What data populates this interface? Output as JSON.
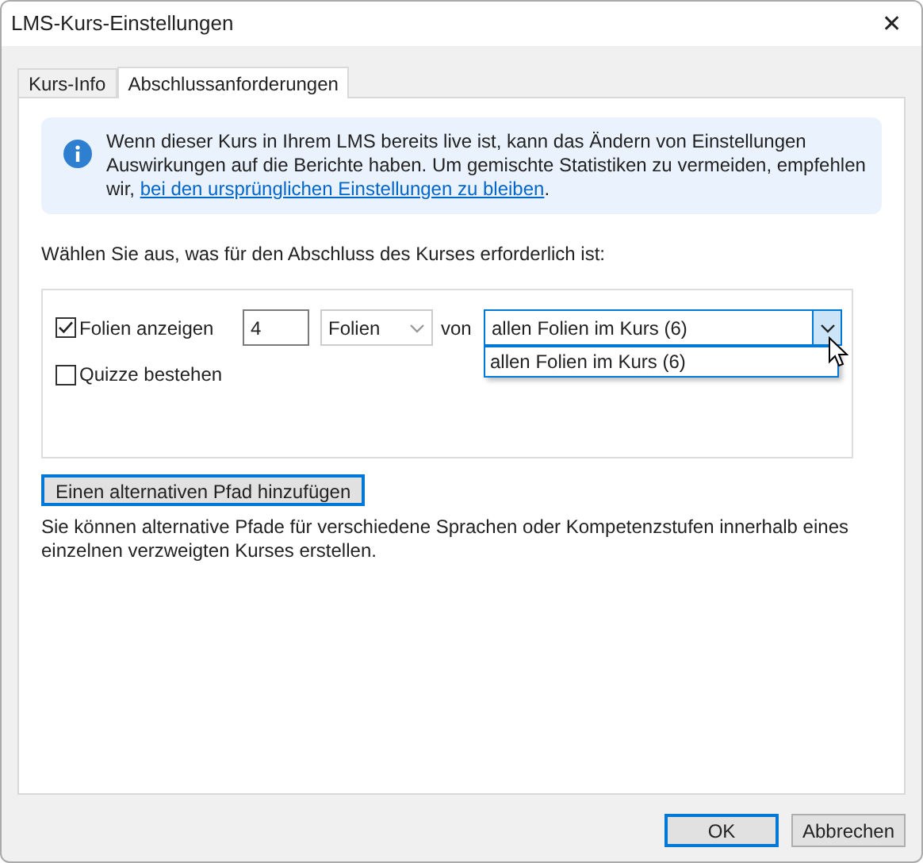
{
  "window": {
    "title": "LMS-Kurs-Einstellungen",
    "close": "✕"
  },
  "tabs": [
    {
      "label": "Kurs-Info",
      "selected": false
    },
    {
      "label": "Abschlussanforderungen",
      "selected": true
    }
  ],
  "info": {
    "text": "Wenn dieser Kurs in Ihrem LMS bereits live ist, kann das Ändern von Einstellungen Auswirkungen auf die Berichte haben. Um gemischte Statistiken zu vermeiden, empfehlen wir, ",
    "link": "bei den ursprünglichen Einstellungen zu bleiben",
    "after": "."
  },
  "prompt": "Wählen Sie aus, was für den Abschluss des Kurses erforderlich ist:",
  "requirements": [
    {
      "kind": "slides",
      "label": "Folien anzeigen",
      "checked": true,
      "count": "4",
      "unit": "Folien",
      "of": "von",
      "scope": "allen Folien im Kurs (6)",
      "expanded": true,
      "options": [
        "allen Folien im Kurs (6)"
      ]
    },
    {
      "kind": "quiz",
      "label": "Quizze bestehen",
      "checked": false
    }
  ],
  "add_path_button": "Einen alternativen Pfad hinzufügen",
  "note": "Sie können alternative Pfade für verschiedene Sprachen oder Kompetenzstufen innerhalb eines einzelnen verzweigten Kurses erstellen.",
  "buttons": [
    {
      "label": "OK",
      "selected": true
    },
    {
      "label": "Abbrechen",
      "selected": false
    }
  ]
}
